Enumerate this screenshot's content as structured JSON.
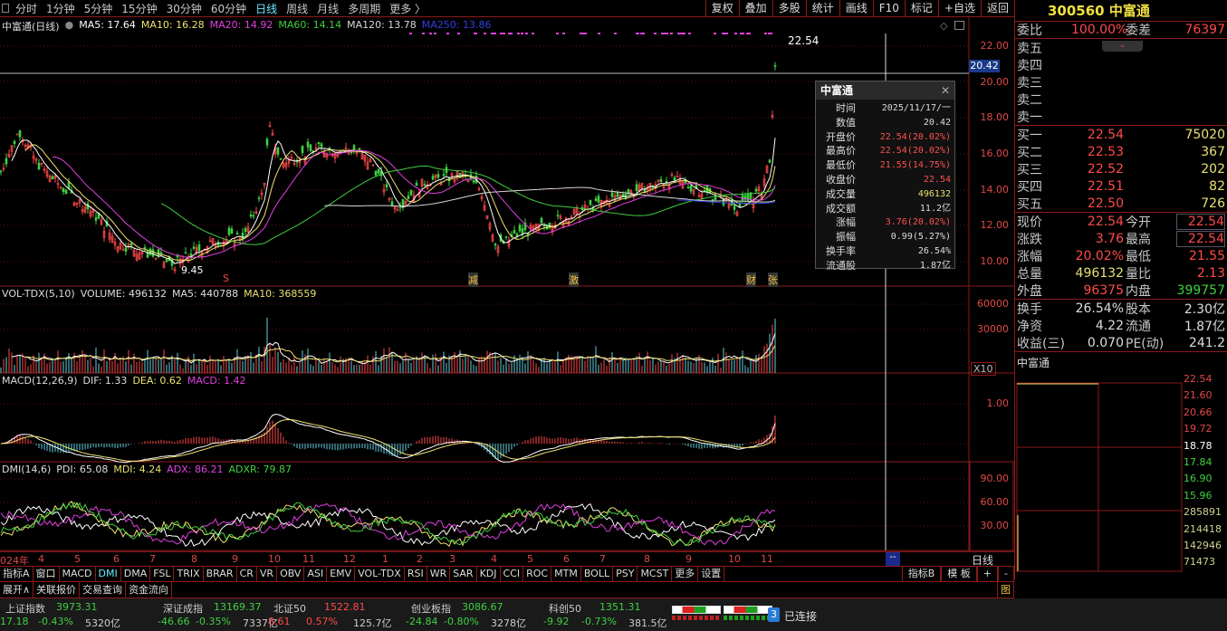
{
  "toolbar": {
    "periods": [
      "分时",
      "1分钟",
      "5分钟",
      "15分钟",
      "30分钟",
      "60分钟",
      "日线",
      "周线",
      "月线",
      "多周期",
      "更多 〉"
    ],
    "active": "日线",
    "buttons": [
      "复权",
      "叠加",
      "多股",
      "统计",
      "画线",
      "F10",
      "标记",
      "+自选",
      "返回"
    ]
  },
  "price_legend": {
    "title": "中富通(日线)",
    "ma5": "MA5: 17.64",
    "ma10": "MA10: 16.28",
    "ma20": "MA20: 14.92",
    "ma60": "MA60: 14.14",
    "ma120": "MA120: 13.78",
    "ma250": "MA250: 13.86"
  },
  "price_axis": [
    "22.00",
    "20.00",
    "18.00",
    "16.00",
    "14.00",
    "12.00",
    "10.00"
  ],
  "crosshair_price": "20.42",
  "high_mark": "22.54",
  "low_mark": "9.45",
  "markers": [
    "S",
    "减",
    "激",
    "财",
    "张"
  ],
  "vol_legend": {
    "name": "VOL-TDX(5,10)",
    "volume": "VOLUME: 496132",
    "ma5": "MA5: 440788",
    "ma10": "MA10: 368559"
  },
  "vol_axis": [
    "60000",
    "30000"
  ],
  "vol_unit": "X10",
  "macd_legend": {
    "name": "MACD(12,26,9)",
    "dif": "DIF: 1.33",
    "dea": "DEA: 0.62",
    "macd": "MACD: 1.42"
  },
  "macd_axis": [
    "1.00"
  ],
  "dmi_legend": {
    "name": "DMI(14,6)",
    "pdi": "PDI: 65.08",
    "mdi": "MDI: 4.24",
    "adx": "ADX: 86.21",
    "adxr": "ADXR: 79.87"
  },
  "dmi_axis": [
    "90.00",
    "60.00",
    "30.00"
  ],
  "dates": [
    "024年",
    "4",
    "5",
    "6",
    "7",
    "8",
    "9",
    "10",
    "11",
    "12",
    "1",
    "2",
    "3",
    "4",
    "5",
    "6",
    "7",
    "8",
    "9",
    "10",
    "11"
  ],
  "period_label": "日线",
  "cursor_date": "--",
  "popup": {
    "title": "中富通",
    "rows": [
      [
        "时间",
        "2025/11/17/一"
      ],
      [
        "数值",
        "20.42"
      ],
      [
        "开盘价",
        "22.54(20.02%)"
      ],
      [
        "最高价",
        "22.54(20.02%)"
      ],
      [
        "最低价",
        "21.55(14.75%)"
      ],
      [
        "收盘价",
        "22.54"
      ],
      [
        "成交量",
        "496132"
      ],
      [
        "成交额",
        "11.2亿"
      ],
      [
        "涨幅",
        "3.76(20.02%)"
      ],
      [
        "振幅",
        "0.99(5.27%)"
      ],
      [
        "换手率",
        "26.54%"
      ],
      [
        "流通股",
        "1.87亿"
      ]
    ]
  },
  "indicator_tabs": [
    "指标A",
    "窗口",
    "MACD",
    "DMI",
    "DMA",
    "FSL",
    "TRIX",
    "BRAR",
    "CR",
    "VR",
    "OBV",
    "ASI",
    "EMV",
    "VOL-TDX",
    "RSI",
    "WR",
    "SAR",
    "KDJ",
    "CCI",
    "ROC",
    "MTM",
    "BOLL",
    "PSY",
    "MCST",
    "更多",
    "设置"
  ],
  "indicator_right": [
    "指标B",
    "模 板",
    "+",
    "-"
  ],
  "bottom_tabs": [
    "展开∧",
    "关联报价",
    "交易查询",
    "资金流向"
  ],
  "bottom_right": "图",
  "quote": {
    "code": "300560",
    "name": "中富通",
    "weibi_label": "委比",
    "weibi": "100.00%",
    "weicha_label": "委差",
    "weicha": "76397",
    "sell": [
      [
        "卖五",
        "",
        ""
      ],
      [
        "卖四",
        "",
        ""
      ],
      [
        "卖三",
        "",
        ""
      ],
      [
        "卖二",
        "",
        ""
      ],
      [
        "卖一",
        "",
        ""
      ]
    ],
    "buy": [
      [
        "买一",
        "22.54",
        "75020"
      ],
      [
        "买二",
        "22.53",
        "367"
      ],
      [
        "买三",
        "22.52",
        "202"
      ],
      [
        "买四",
        "22.51",
        "82"
      ],
      [
        "买五",
        "22.50",
        "726"
      ]
    ],
    "stats": [
      [
        "现价",
        "22.54",
        "今开",
        "22.54"
      ],
      [
        "涨跌",
        "3.76",
        "最高",
        "22.54"
      ],
      [
        "涨幅",
        "20.02%",
        "最低",
        "21.55"
      ],
      [
        "总量",
        "496132",
        "量比",
        "2.13"
      ],
      [
        "外盘",
        "96375",
        "内盘",
        "399757"
      ]
    ],
    "fund": [
      [
        "换手",
        "26.54%",
        "股本",
        "2.30亿"
      ],
      [
        "净资",
        "4.22",
        "流通",
        "1.87亿"
      ],
      [
        "收益(三)",
        "0.070",
        "PE(动)",
        "241.2"
      ]
    ]
  },
  "mini": {
    "title": "中富通",
    "axis": [
      "22.54",
      "21.60",
      "20.66",
      "19.72",
      "18.78",
      "17.84",
      "16.90",
      "15.96",
      "285891",
      "214418",
      "142946",
      "71473"
    ]
  },
  "indices": [
    {
      "name": "上证指数",
      "value": "3973.31",
      "chg": "17.18",
      "pct": "-0.43%",
      "amt": "5320亿",
      "up": false
    },
    {
      "name": "深证成指",
      "value": "13169.37",
      "chg": "-46.66",
      "pct": "-0.35%",
      "amt": "7337亿",
      "up": false
    },
    {
      "name": "北证50",
      "value": "1522.81",
      "chg": "8.61",
      "pct": "0.57%",
      "amt": "125.7亿",
      "up": true
    },
    {
      "name": "创业板指",
      "value": "3086.67",
      "chg": "-24.84",
      "pct": "-0.80%",
      "amt": "3278亿",
      "up": false
    },
    {
      "name": "科创50",
      "value": "1351.31",
      "chg": "-9.92",
      "pct": "-0.73%",
      "amt": "381.5亿",
      "up": false
    }
  ],
  "connection": {
    "count": "3",
    "label": "已连接"
  },
  "colors": {
    "up": "#ff4a4a",
    "down": "#3fd03f",
    "border": "#8b1a1a",
    "ma5": "#ffffff",
    "ma10": "#f0e070",
    "ma20": "#e040e0",
    "ma60": "#40d040",
    "ma120": "#d8d8d8",
    "ma250": "#3040e0"
  }
}
